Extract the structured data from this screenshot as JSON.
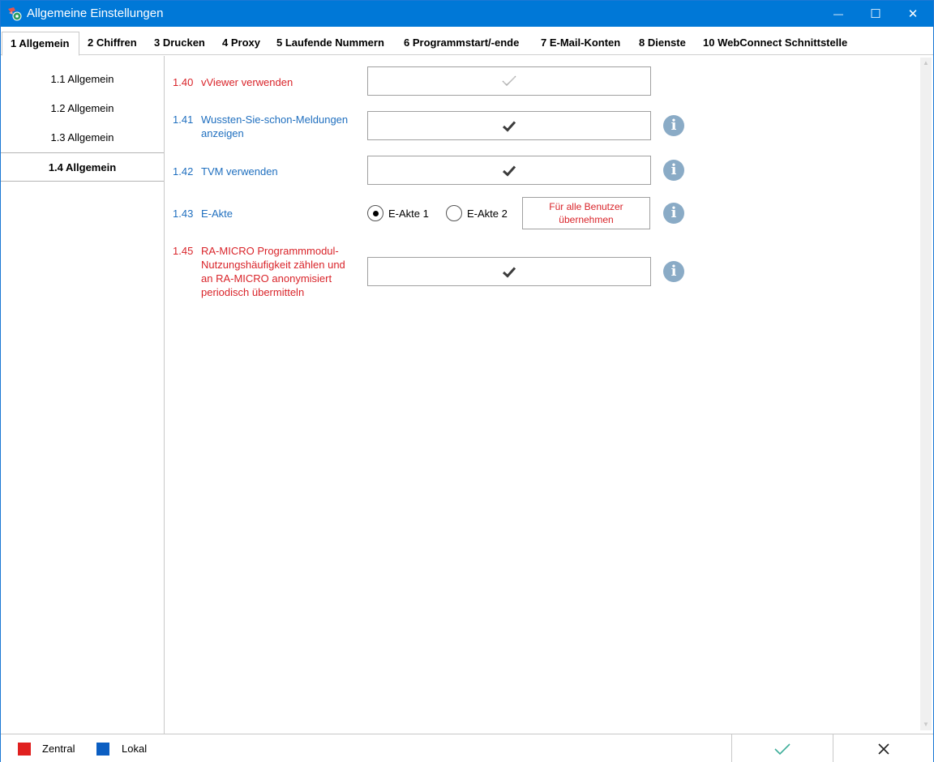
{
  "window": {
    "title": "Allgemeine Einstellungen",
    "minimize_glyph": "—",
    "maximize_glyph": "☐",
    "close_glyph": "✕"
  },
  "tabs": [
    {
      "label": "1 Allgemein",
      "active": true
    },
    {
      "label": "2 Chiffren"
    },
    {
      "label": "3 Drucken"
    },
    {
      "label": "4 Proxy"
    },
    {
      "label": "5 Laufende Nummern"
    },
    {
      "label": "6 Programmstart/-ende"
    },
    {
      "label": "7 E-Mail-Konten"
    },
    {
      "label": "8 Dienste"
    },
    {
      "label": "10 WebConnect Schnittstelle"
    }
  ],
  "sidebar": {
    "items": [
      {
        "label": "1.1 Allgemein"
      },
      {
        "label": "1.2 Allgemein"
      },
      {
        "label": "1.3 Allgemein"
      },
      {
        "label": "1.4 Allgemein",
        "active": true
      }
    ]
  },
  "settings": {
    "vviewer": {
      "number": "1.40",
      "label": "vViewer verwenden",
      "checked": true,
      "scope": "zentral"
    },
    "wussten": {
      "number": "1.41",
      "label": "Wussten-Sie-schon-Meldungen anzeigen",
      "checked": true,
      "scope": "lokal"
    },
    "tvm": {
      "number": "1.42",
      "label": "TVM verwenden",
      "checked": true,
      "scope": "lokal"
    },
    "eakte": {
      "number": "1.43",
      "label": "E-Akte",
      "option1": "E-Akte 1",
      "option2": "E-Akte 2",
      "selected": "E-Akte 1",
      "apply_button": "Für alle Benutzer übernehmen",
      "scope": "lokal"
    },
    "ramicro": {
      "number": "1.45",
      "label": "RA-MICRO Programmmodul-Nutzungshäufigkeit zählen und an RA-MICRO anonymisiert periodisch übermitteln",
      "checked": true,
      "scope": "zentral"
    }
  },
  "icons": {
    "check": "check-icon",
    "info": "info-icon",
    "info_glyph": "i"
  },
  "footer": {
    "legend": [
      {
        "label": "Zentral",
        "color": "#e0201f"
      },
      {
        "label": "Lokal",
        "color": "#0b5ec2"
      }
    ],
    "ok_icon": "checkmark-icon",
    "cancel_icon": "close-icon"
  },
  "colors": {
    "titlebar": "#0078d7",
    "zentral": "#d9242a",
    "lokal": "#1f6fbf",
    "info": "#8aabc6"
  }
}
